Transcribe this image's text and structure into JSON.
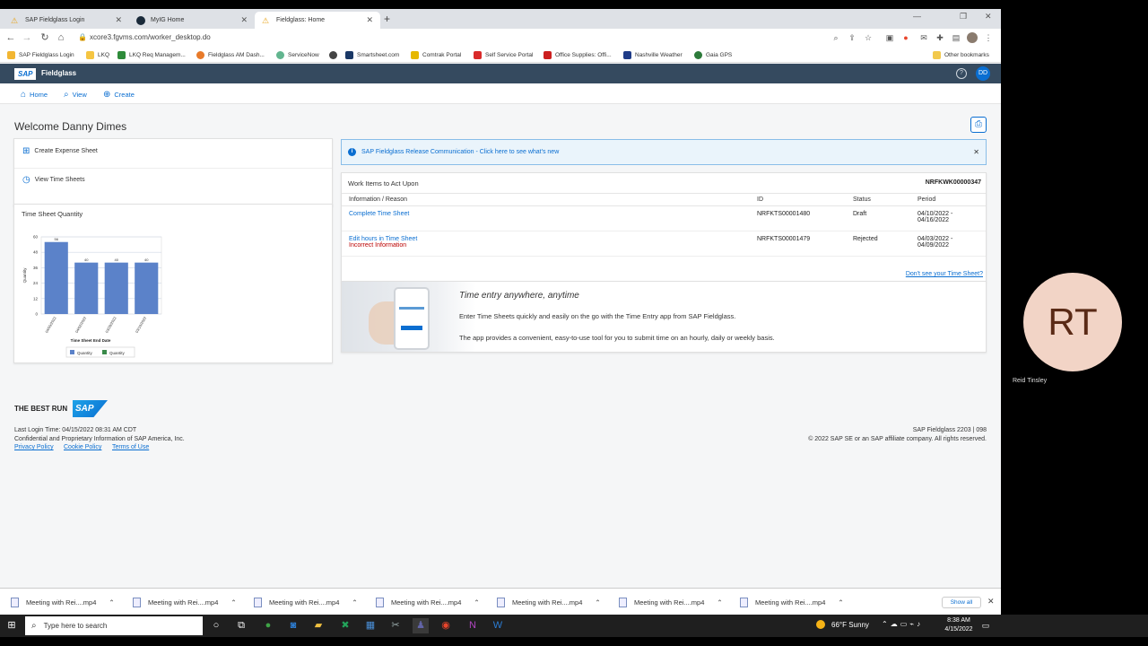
{
  "browser": {
    "tabs": [
      {
        "title": "SAP Fieldglass Login",
        "active": false
      },
      {
        "title": "MyIG Home",
        "active": false
      },
      {
        "title": "Fieldglass: Home",
        "active": true
      }
    ],
    "new_tab": "+",
    "window_controls": {
      "minimize": "—",
      "restore": "❐",
      "close": "✕"
    },
    "url": "xcore3.fgvms.com/worker_desktop.do",
    "bookmarks": [
      "SAP Fieldglass Login",
      "LKQ",
      "LKQ Req Managem...",
      "Fieldglass AM Dash...",
      "ServiceNow",
      "",
      "Smartsheet.com",
      "Comtrak Portal",
      "Self Service Portal",
      "Office Supplies: Offi...",
      "Nashville Weather",
      "Gaia GPS"
    ],
    "other_bookmarks": "Other bookmarks"
  },
  "shell": {
    "logo": "SAP",
    "product": "Fieldglass",
    "help": "?",
    "user_initials": "DD"
  },
  "nav": {
    "home": "Home",
    "view": "View",
    "create": "Create"
  },
  "page": {
    "welcome": "Welcome Danny Dimes"
  },
  "quick_links": {
    "create_expense": "Create Expense Sheet",
    "view_time": "View Time Sheets"
  },
  "chart_card": {
    "title": "Time Sheet Quantity",
    "legend_1": "Quantity",
    "legend_2": "Quantity"
  },
  "chart_data": {
    "type": "bar",
    "categories": [
      "04/09/2022",
      "04/02/2022",
      "03/26/2022",
      "03/19/2022"
    ],
    "values": [
      56,
      40,
      40,
      40
    ],
    "xlabel": "Time Sheet End Date",
    "ylabel": "Quantity",
    "ylim": [
      0,
      60
    ],
    "yticks": [
      0,
      12,
      24,
      36,
      48,
      60
    ],
    "colors": {
      "bar": "#5b82c9"
    },
    "legend": "bottom"
  },
  "release": {
    "text": "SAP Fieldglass Release Communication - Click here to see what's new",
    "close": "✕"
  },
  "work_items": {
    "title": "Work Items to Act Upon",
    "worker_id": "NRFKWK00000347",
    "headers": [
      "Information / Reason",
      "ID",
      "Status",
      "Period"
    ],
    "rows": [
      {
        "info": "Complete Time Sheet",
        "reason": "",
        "id": "NRFKTS00001480",
        "status": "Draft",
        "period1": "04/10/2022 -",
        "period2": "04/16/2022"
      },
      {
        "info": "Edit hours in Time Sheet",
        "reason": "Incorrect Information",
        "id": "NRFKTS00001479",
        "status": "Rejected",
        "period1": "04/03/2022 -",
        "period2": "04/09/2022"
      }
    ],
    "dont_see": "Don't see your Time Sheet?"
  },
  "promo": {
    "title": "Time entry anywhere, anytime",
    "line1": "Enter Time Sheets quickly and easily on the go with the Time Entry app from SAP Fieldglass.",
    "line2": "The app provides a convenient, easy-to-use tool for you to submit time on an hourly, daily or weekly basis."
  },
  "footer": {
    "best_run": "THE BEST RUN",
    "sap": "SAP",
    "last_login": "Last Login Time: 04/15/2022 08:31 AM CDT",
    "confidential": "Confidential and Proprietary Information of SAP America, Inc.",
    "privacy": "Privacy Policy",
    "cookie": "Cookie Policy",
    "terms": "Terms of Use",
    "version": "SAP Fieldglass 2203 | 098",
    "copyright": "© 2022 SAP SE or an SAP affiliate company. All rights reserved."
  },
  "downloads": {
    "items": [
      "Meeting with Rei....mp4",
      "Meeting with Rei....mp4",
      "Meeting with Rei....mp4",
      "Meeting with Rei....mp4",
      "Meeting with Rei....mp4",
      "Meeting with Rei....mp4",
      "Meeting with Rei....mp4"
    ],
    "show_all": "Show all",
    "close": "✕"
  },
  "participant": {
    "initials": "RT",
    "name": "Reid Tinsley"
  },
  "taskbar": {
    "search": "Type here to search",
    "weather": "66°F  Sunny",
    "time": "8:38 AM",
    "date": "4/15/2022"
  }
}
